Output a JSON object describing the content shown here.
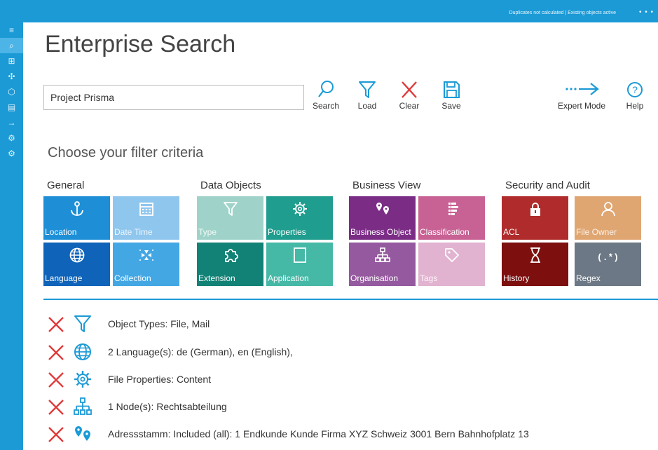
{
  "topbar": {
    "status": "Duplicates not calculated | Existing objects active",
    "dots": "• • •"
  },
  "page": {
    "title": "Enterprise Search",
    "subtitle": "Choose your filter criteria"
  },
  "search": {
    "value": "Project Prisma"
  },
  "toolbar": {
    "search_label": "Search",
    "load_label": "Load",
    "clear_label": "Clear",
    "save_label": "Save",
    "expert_label": "Expert Mode",
    "help_label": "Help"
  },
  "groups": {
    "general": "General",
    "data_objects": "Data Objects",
    "business_view": "Business View",
    "security": "Security and Audit"
  },
  "tiles": {
    "location": "Location",
    "datetime": "Date Time",
    "type": "Type",
    "properties": "Properties",
    "business_object": "Business Object",
    "classification": "Classification",
    "acl": "ACL",
    "file_owner": "File Owner",
    "language": "Language",
    "collection": "Collection",
    "extension": "Extension",
    "application": "Application",
    "organisation": "Organisation",
    "tags": "Tags",
    "history": "History",
    "regex": "Regex",
    "regex_symbol": "(.*)"
  },
  "criteria": [
    {
      "icon": "filter-icon",
      "text": "Object Types: File, Mail"
    },
    {
      "icon": "globe-icon",
      "text": "2 Language(s): de (German), en (English),"
    },
    {
      "icon": "gear-icon",
      "text": "File Properties: Content"
    },
    {
      "icon": "org-chart-icon",
      "text": "1 Node(s): Rechtsabteilung"
    },
    {
      "icon": "location-pins-icon",
      "text": "Adressstamm: Included (all): 1 Endkunde Kunde Firma XYZ Schweiz 3001 Bern Bahnhofplatz 13"
    }
  ],
  "colors": {
    "accent": "#1b9ad6",
    "clear_red": "#e03a3a",
    "general_blue": "#1e8fd6",
    "general_light": "#8fc6ee",
    "data_teal": "#1f9d8e",
    "data_light": "#9fd3c9",
    "business_purple": "#7b2d86",
    "business_pink": "#c86294",
    "security_red": "#b02b2b",
    "security_tan": "#e0a672",
    "security_gray": "#6c7885"
  }
}
